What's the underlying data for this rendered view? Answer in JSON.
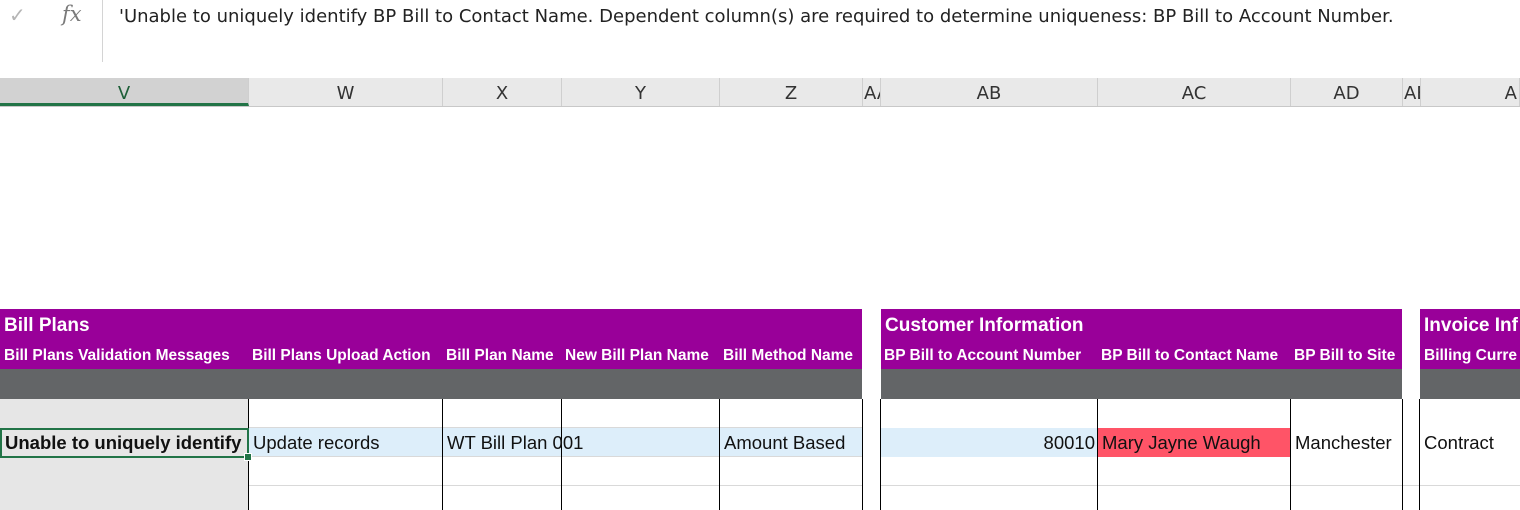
{
  "formula_bar": {
    "check_icon": "check-icon",
    "fx_label": "fx",
    "content": "'Unable to uniquely identify BP Bill to Contact Name. Dependent column(s) are required to determine uniqueness: BP Bill to Account Number."
  },
  "columns": [
    "V",
    "W",
    "X",
    "Y",
    "Z",
    "AA",
    "AB",
    "AC",
    "AD",
    "AE",
    "A"
  ],
  "sections": {
    "bill_plans": "Bill Plans",
    "customer_info": "Customer Information",
    "invoice_info": "Invoice Inf"
  },
  "subheaders": {
    "v": "Bill Plans Validation Messages",
    "w": "Bill Plans Upload Action",
    "x": "Bill Plan Name",
    "y": "New Bill Plan Name",
    "z": "Bill Method Name",
    "ab": "BP Bill to Account Number",
    "ac": "BP Bill to Contact Name",
    "ad": "BP Bill to Site",
    "af": "Billing Curre"
  },
  "row": {
    "v": "Unable to uniquely identify",
    "w": "Update records",
    "x": "WT Bill Plan 001",
    "z": "Amount Based",
    "ab": "80010",
    "ac": "Mary Jayne Waugh",
    "ad": "Manchester",
    "af": "Contract"
  },
  "colors": {
    "section_header": "#990099",
    "gray_band": "#636567",
    "error_cell": "#ff5467",
    "row_highlight": "#ddeefa",
    "selected_column": "#e6e6e6"
  }
}
